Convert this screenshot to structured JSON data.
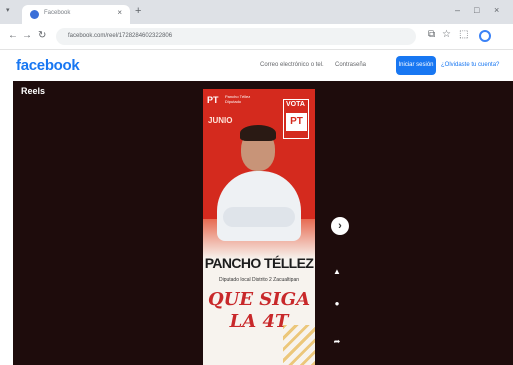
{
  "browser": {
    "tab_menu_icon": "chevron-down-icon",
    "tab_title": "Facebook",
    "tab_close": "×",
    "new_tab": "+",
    "window_controls": [
      "–",
      "□",
      "×"
    ],
    "nav": {
      "back": "←",
      "forward": "→",
      "reload": "↻",
      "site_info": "⊶"
    },
    "url": "facebook.com/reel/1728284602322806",
    "toolbar_icons": [
      "⧉",
      "☆",
      "⬚"
    ]
  },
  "facebook": {
    "logo": "facebook",
    "email_placeholder": "Correo electrónico o tel.",
    "password_placeholder": "Contraseña",
    "login_label": "Iniciar sesión",
    "forgot_label": "¿Olvidaste tu cuenta?",
    "brand_color": "#1877f2"
  },
  "reels": {
    "title": "Reels",
    "video": {
      "badge_small": "PT",
      "name_small": "Pancho Téllez",
      "name_small_line2": "Diputado",
      "date": "JUNIO",
      "vote_label": "VOTA",
      "party_logo": "PT",
      "candidate_name": "PANCHO TÉLLEZ",
      "subtitle": "Diputado local Distrito 2 Zacualtipan",
      "slogan_line1": "QUE SIGA",
      "slogan_line2": "LA 4T"
    },
    "next_button": "›",
    "actions": [
      {
        "icon": "thumbs-up-icon",
        "glyph": "▲",
        "count": ""
      },
      {
        "icon": "comment-icon",
        "glyph": "●",
        "count": ""
      },
      {
        "icon": "share-icon",
        "glyph": "➦",
        "count": ""
      }
    ]
  }
}
